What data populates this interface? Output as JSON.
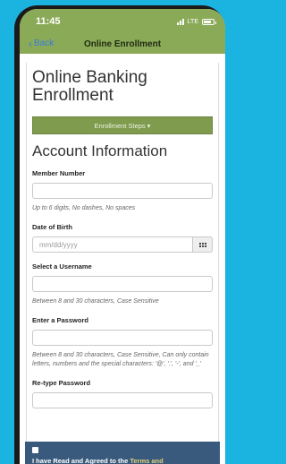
{
  "status_bar": {
    "time": "11:45",
    "network": "LTE"
  },
  "navbar": {
    "back_label": "Back",
    "title": "Online Enrollment"
  },
  "page": {
    "title": "Online Banking Enrollment",
    "steps_button": "Enrollment Steps",
    "section_title": "Account Information"
  },
  "form": {
    "member_number": {
      "label": "Member Number",
      "hint": "Up to 6 digits, No dashes, No spaces"
    },
    "date_of_birth": {
      "label": "Date of Birth",
      "placeholder": "mm/dd/yyyy"
    },
    "username": {
      "label": "Select a Username",
      "hint": "Between 8 and 30 characters, Case Sensitive"
    },
    "password": {
      "label": "Enter a Password",
      "hint": "Between 8 and 30 characters, Case Sensitive, Can only contain letters, numbers and the special characters: '@', '.', '-', and '_'"
    },
    "retype_password": {
      "label": "Re-type Password"
    }
  },
  "terms": {
    "text": "I have Read and Agreed to the ",
    "link": "Terms and"
  },
  "colors": {
    "header_green": "#8aaa58",
    "button_green": "#7f9b4e",
    "terms_blue": "#395a7c",
    "background": "#1bb3df"
  }
}
